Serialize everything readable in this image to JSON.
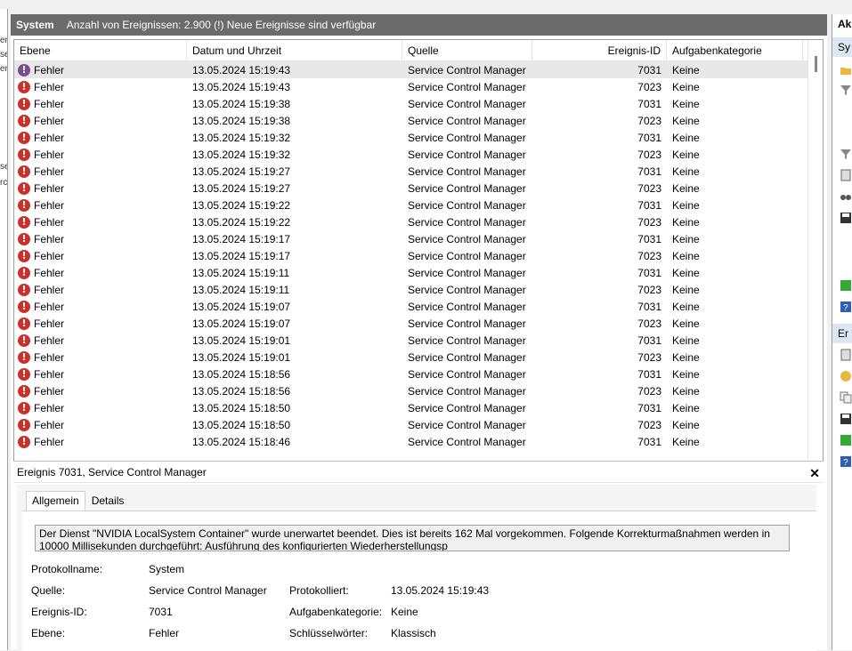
{
  "header": {
    "log_name": "System",
    "event_count_text": "Anzahl von Ereignissen: 2.900 (!) Neue Ereignisse sind verfügbar"
  },
  "columns": {
    "level": "Ebene",
    "datetime": "Datum und Uhrzeit",
    "source": "Quelle",
    "event_id": "Ereignis-ID",
    "task_category": "Aufgabenkategorie"
  },
  "events": [
    {
      "level": "Fehler",
      "datetime": "13.05.2024 15:19:43",
      "source": "Service Control Manager",
      "id": "7031",
      "task": "Keine"
    },
    {
      "level": "Fehler",
      "datetime": "13.05.2024 15:19:43",
      "source": "Service Control Manager",
      "id": "7023",
      "task": "Keine"
    },
    {
      "level": "Fehler",
      "datetime": "13.05.2024 15:19:38",
      "source": "Service Control Manager",
      "id": "7031",
      "task": "Keine"
    },
    {
      "level": "Fehler",
      "datetime": "13.05.2024 15:19:38",
      "source": "Service Control Manager",
      "id": "7023",
      "task": "Keine"
    },
    {
      "level": "Fehler",
      "datetime": "13.05.2024 15:19:32",
      "source": "Service Control Manager",
      "id": "7031",
      "task": "Keine"
    },
    {
      "level": "Fehler",
      "datetime": "13.05.2024 15:19:32",
      "source": "Service Control Manager",
      "id": "7023",
      "task": "Keine"
    },
    {
      "level": "Fehler",
      "datetime": "13.05.2024 15:19:27",
      "source": "Service Control Manager",
      "id": "7031",
      "task": "Keine"
    },
    {
      "level": "Fehler",
      "datetime": "13.05.2024 15:19:27",
      "source": "Service Control Manager",
      "id": "7023",
      "task": "Keine"
    },
    {
      "level": "Fehler",
      "datetime": "13.05.2024 15:19:22",
      "source": "Service Control Manager",
      "id": "7031",
      "task": "Keine"
    },
    {
      "level": "Fehler",
      "datetime": "13.05.2024 15:19:22",
      "source": "Service Control Manager",
      "id": "7023",
      "task": "Keine"
    },
    {
      "level": "Fehler",
      "datetime": "13.05.2024 15:19:17",
      "source": "Service Control Manager",
      "id": "7031",
      "task": "Keine"
    },
    {
      "level": "Fehler",
      "datetime": "13.05.2024 15:19:17",
      "source": "Service Control Manager",
      "id": "7023",
      "task": "Keine"
    },
    {
      "level": "Fehler",
      "datetime": "13.05.2024 15:19:11",
      "source": "Service Control Manager",
      "id": "7031",
      "task": "Keine"
    },
    {
      "level": "Fehler",
      "datetime": "13.05.2024 15:19:11",
      "source": "Service Control Manager",
      "id": "7023",
      "task": "Keine"
    },
    {
      "level": "Fehler",
      "datetime": "13.05.2024 15:19:07",
      "source": "Service Control Manager",
      "id": "7031",
      "task": "Keine"
    },
    {
      "level": "Fehler",
      "datetime": "13.05.2024 15:19:07",
      "source": "Service Control Manager",
      "id": "7023",
      "task": "Keine"
    },
    {
      "level": "Fehler",
      "datetime": "13.05.2024 15:19:01",
      "source": "Service Control Manager",
      "id": "7031",
      "task": "Keine"
    },
    {
      "level": "Fehler",
      "datetime": "13.05.2024 15:19:01",
      "source": "Service Control Manager",
      "id": "7023",
      "task": "Keine"
    },
    {
      "level": "Fehler",
      "datetime": "13.05.2024 15:18:56",
      "source": "Service Control Manager",
      "id": "7031",
      "task": "Keine"
    },
    {
      "level": "Fehler",
      "datetime": "13.05.2024 15:18:56",
      "source": "Service Control Manager",
      "id": "7023",
      "task": "Keine"
    },
    {
      "level": "Fehler",
      "datetime": "13.05.2024 15:18:50",
      "source": "Service Control Manager",
      "id": "7031",
      "task": "Keine"
    },
    {
      "level": "Fehler",
      "datetime": "13.05.2024 15:18:50",
      "source": "Service Control Manager",
      "id": "7023",
      "task": "Keine"
    },
    {
      "level": "Fehler",
      "datetime": "13.05.2024 15:18:46",
      "source": "Service Control Manager",
      "id": "7031",
      "task": "Keine"
    }
  ],
  "detail": {
    "title": "Ereignis 7031, Service Control Manager",
    "tab_general": "Allgemein",
    "tab_details": "Details",
    "description": "Der Dienst \"NVIDIA LocalSystem Container\" wurde unerwartet beendet. Dies ist bereits 162 Mal vorgekommen. Folgende Korrekturmaßnahmen werden in 10000 Millisekunden durchgeführt: Ausführung des konfigurierten Wiederherstellungsp",
    "labels": {
      "log_name": "Protokollname:",
      "source": "Quelle:",
      "event_id": "Ereignis-ID:",
      "level": "Ebene:",
      "logged": "Protokolliert:",
      "task_category": "Aufgabenkategorie:",
      "keywords": "Schlüsselwörter:"
    },
    "values": {
      "log_name": "System",
      "source": "Service Control Manager",
      "event_id": "7031",
      "level": "Fehler",
      "logged": "13.05.2024 15:19:43",
      "task_category": "Keine",
      "keywords": "Klassisch"
    }
  },
  "right_panel": {
    "header1": "Ak",
    "header2": "Sy",
    "header3": "Er"
  },
  "left_fragments": [
    "er",
    "se",
    "er",
    "se",
    "rc"
  ]
}
